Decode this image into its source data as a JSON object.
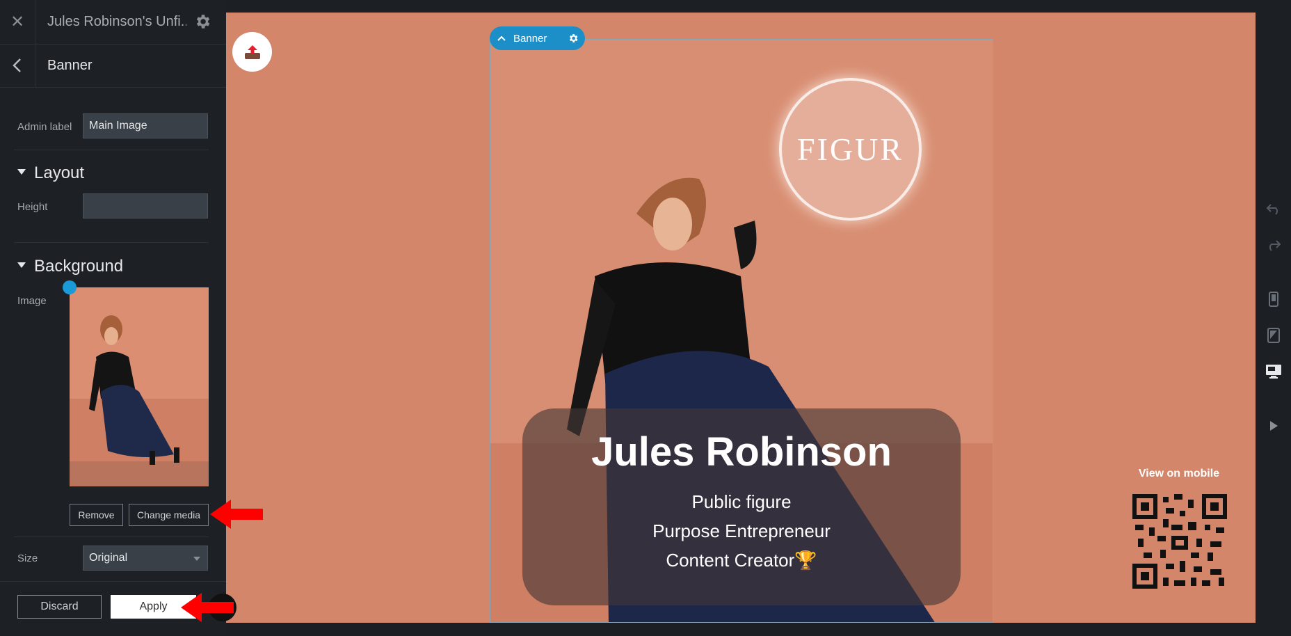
{
  "header": {
    "close_icon": "close-icon",
    "site_title": "Jules Robinson's Unfi...",
    "settings_icon": "gear-icon"
  },
  "breadcrumb": {
    "title": "Banner"
  },
  "fields": {
    "admin_label": "Admin label",
    "admin_value": "Main Image",
    "layout_title": "Layout",
    "height_label": "Height",
    "height_value": "",
    "background_title": "Background",
    "image_label": "Image",
    "remove_label": "Remove",
    "change_media_label": "Change media",
    "size_label": "Size",
    "size_value": "Original"
  },
  "footer": {
    "discard_label": "Discard",
    "apply_label": "Apply"
  },
  "canvas": {
    "banner_tag_label": "Banner",
    "logo_text": "FIGUR",
    "name": "Jules Robinson",
    "line1": "Public figure",
    "line2": "Purpose Entrepreneur",
    "line3": "Content Creator🏆",
    "qr_title": "View on mobile"
  },
  "colors": {
    "accent": "#1c8fc8",
    "canvas_bg": "#d4866a",
    "panel_bg": "#1d2126",
    "annotation_arrow": "#ff0000"
  }
}
